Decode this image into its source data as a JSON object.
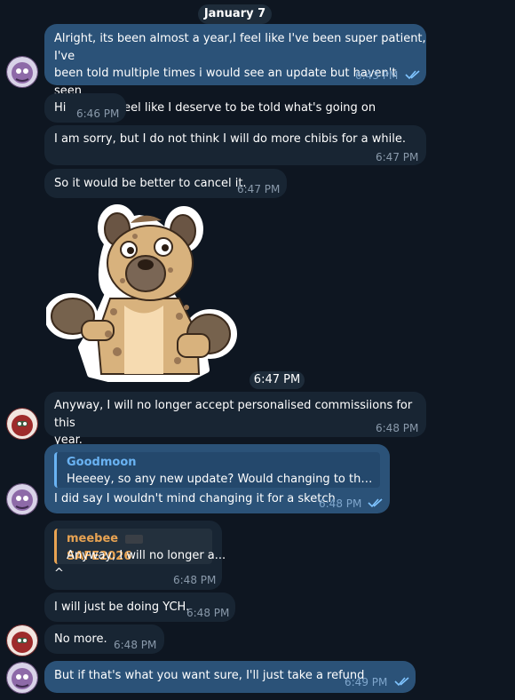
{
  "chat": {
    "date_separator": "January 7",
    "messages": [
      {
        "text": "Alright, its been almost a year,I feel like I've been super patient, I've\nbeen told multiple times i would see an update but haven't seen\nanything, I feel like I deserve to be told what's going on",
        "time": "6:43 PM"
      },
      {
        "text": "Hi",
        "time": "6:46 PM"
      },
      {
        "text": "I am sorry, but I do not think I will do more chibis for a while.",
        "time": "6:47 PM"
      },
      {
        "text": "So it would be better to cancel it.",
        "time": "6:47 PM"
      },
      {
        "sticker": "hyena-shrug-sticker",
        "time": "6:47 PM"
      },
      {
        "text": "Anyway, I will no longer accept personalised commissiions for this\nyear.",
        "time": "6:48 PM"
      },
      {
        "reply_name": "Goodmoon",
        "reply_text": "Heeeey, so any new update? Would changing to the sket...",
        "text": "I did say I wouldn't mind changing it for a sketch",
        "time": "6:48 PM"
      },
      {
        "reply_name": "meebee",
        "reply_tag": "SAFE2026",
        "reply_text": "Anyway, I will no longer a...",
        "text": "^",
        "time": "6:48 PM"
      },
      {
        "text": "I will just be doing YCH.",
        "time": "6:48 PM"
      },
      {
        "text": "No more.",
        "time": "6:48 PM"
      },
      {
        "text": "But if that's what you want sure, I'll just take a refund",
        "time": "6:49 PM"
      }
    ]
  },
  "colors": {
    "background": "#0e1621",
    "incoming_bubble": "#182533",
    "outgoing_bubble": "#2b5278",
    "reply_blue": "#6ab3f3",
    "reply_orange": "#e8a352"
  }
}
